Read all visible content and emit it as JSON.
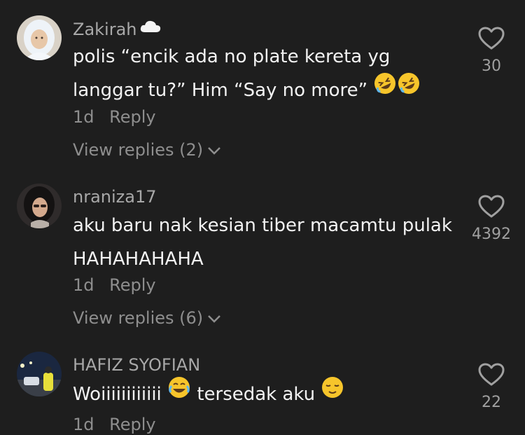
{
  "comments": [
    {
      "username": "Zakirah",
      "username_icon": "cloud-icon",
      "text_before": "polis “encik ada no plate kereta yg langgar tu?” Him “Say no more”",
      "text_after": "",
      "emojis": [
        "rolling-on-floor-laughing-emoji",
        "rolling-on-floor-laughing-emoji"
      ],
      "time": "1d",
      "reply_label": "Reply",
      "view_replies": "View replies (2)",
      "likes": "30"
    },
    {
      "username": "nraniza17",
      "text": "aku baru nak kesian tiber macamtu pulak HAHAHAHAHA",
      "time": "1d",
      "reply_label": "Reply",
      "view_replies": "View replies (6)",
      "likes": "4392"
    },
    {
      "username": "HAFIZ SYOFIAN",
      "text_before": "Woiiiiiiiiiiii",
      "text_middle": "tersedak aku",
      "emojis": [
        "face-with-tears-of-joy-emoji",
        "relieved-face-emoji"
      ],
      "time": "1d",
      "reply_label": "Reply",
      "likes": "22"
    }
  ],
  "colors": {
    "background": "#1e1e1e",
    "text": "#f2f2f2",
    "muted": "#8e8e8e",
    "username": "#a8a8a8",
    "emoji_yellow": "#f7c52b"
  }
}
